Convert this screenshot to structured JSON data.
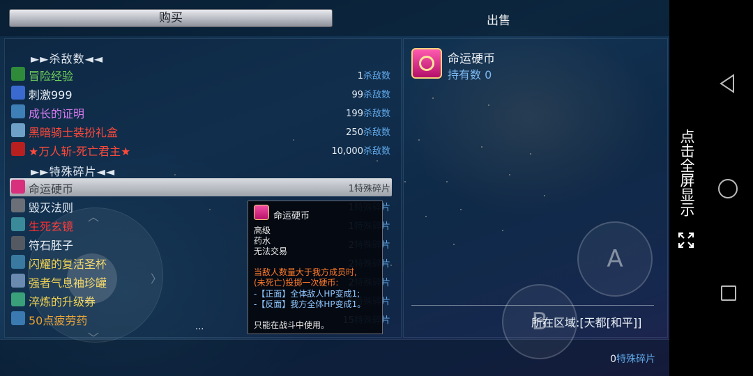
{
  "tabs": {
    "buy": "购买",
    "sell": "出售"
  },
  "sections": {
    "kills": "►►杀敌数◄◄",
    "fragments": "►►特殊碎片◄◄"
  },
  "items": [
    {
      "name": "冒险经验",
      "price": "1",
      "unit": "杀敌数",
      "color": "#6fd15a",
      "icon_color": "#2f8b3a",
      "icon": "leaf-icon"
    },
    {
      "name": "刺激999",
      "price": "99",
      "unit": "杀敌数",
      "color": "#e8eef5",
      "icon_color": "#3a6ad0",
      "icon": "potion-icon"
    },
    {
      "name": "成长的证明",
      "price": "199",
      "unit": "杀敌数",
      "color": "#d77cf0",
      "icon_color": "#3f7fb8",
      "icon": "scroll-icon"
    },
    {
      "name": "黑暗骑士装扮礼盒",
      "price": "250",
      "unit": "杀敌数",
      "color": "#ff4a3a",
      "icon_color": "#6fa0c8",
      "icon": "gift-box-icon"
    },
    {
      "name": "★万人斩-死亡君主★",
      "price": "10,000",
      "unit": "杀敌数",
      "color": "#ff4a3a",
      "icon_color": "#b82020",
      "icon": "skull-icon"
    },
    {
      "name": "命运硬币",
      "price": "1",
      "unit": "特殊碎片",
      "color": "#3a3f46",
      "icon_color": "#d9307e",
      "icon": "coin-icon",
      "selected": true
    },
    {
      "name": "毁灭法则",
      "price": "1",
      "unit": "特殊碎片",
      "color": "#e8eef5",
      "icon_color": "#6a6f78",
      "icon": "blank-icon"
    },
    {
      "name": "生死玄镜",
      "price": "1",
      "unit": "特殊碎片",
      "color": "#ff3030",
      "icon_color": "#3a8a9a",
      "icon": "mirror-icon"
    },
    {
      "name": "符石胚子",
      "price": "2",
      "unit": "特殊碎片",
      "color": "#e8eef5",
      "icon_color": "#555a62",
      "icon": "stone-icon"
    },
    {
      "name": "闪耀的复活圣杯",
      "price": "2",
      "unit": "特殊碎片",
      "color": "#f0d04a",
      "icon_color": "#3a7aa0",
      "icon": "chalice-icon"
    },
    {
      "name": "强者气息袖珍罐",
      "price": "2",
      "unit": "特殊碎片",
      "color": "#f0d04a",
      "icon_color": "#6a8ab0",
      "icon": "jar-icon"
    },
    {
      "name": "淬炼的升级券",
      "price": "5",
      "unit": "特殊碎片",
      "color": "#f0d04a",
      "icon_color": "#3aa07a",
      "icon": "ticket-icon"
    },
    {
      "name": "50点疲劳药",
      "price": "15",
      "unit": "特殊碎片",
      "color": "#e8a030",
      "icon_color": "#3a7ab0",
      "icon": "bottle-icon"
    }
  ],
  "list_more": "...",
  "tooltip": {
    "title": "命运硬币",
    "grade": "高级",
    "type": "药水",
    "trade": "无法交易",
    "desc_1": "当敌人数量大于我方成员时,",
    "desc_2": "(未死亡)投掷一次硬币:",
    "desc_3": "-【正面】全体敌人HP变成1;",
    "desc_4": "-【反面】我方全体HP变成1。",
    "usage": "只能在战斗中使用。"
  },
  "detail": {
    "name": "命运硬币",
    "owned": "持有数 0",
    "region": "所在区域:[天都[和平]]"
  },
  "currency": {
    "amount": "0",
    "unit": "特殊碎片"
  },
  "controls": {
    "a": "A",
    "b": "B"
  },
  "system": {
    "fullscreen_hint": "点击全屏显示"
  }
}
